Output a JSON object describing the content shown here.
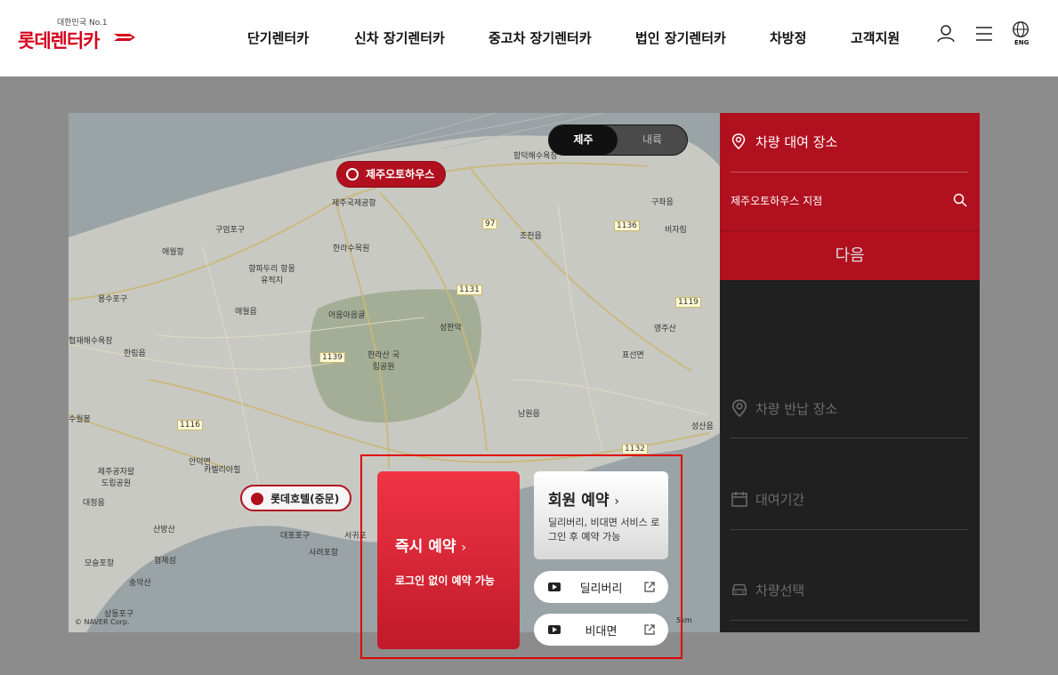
{
  "header": {
    "logo_tagline": "대한민국 No.1",
    "logo_name": "롯데렌터카",
    "nav": [
      "단기렌터카",
      "신차 장기렌터카",
      "중고차 장기렌터카",
      "법인 장기렌터카",
      "차방정",
      "고객지원"
    ],
    "lang_label": "ENG"
  },
  "map": {
    "toggle": {
      "active": "제주",
      "inactive": "내륙"
    },
    "pin_main": "제주오토하우스",
    "pin_secondary": "롯데호텔(중문)",
    "labels": [
      "함덕해수욕장",
      "안덕면",
      "구좌읍",
      "비자림",
      "조천읍",
      "한라수목원",
      "제주국제공항",
      "구엄포구",
      "애월항",
      "애월읍",
      "한림읍",
      "어음아음골",
      "한라산 국립공원",
      "성판악",
      "남원읍",
      "표선면",
      "대정읍",
      "카멜리아힐",
      "서귀포",
      "성산읍",
      "영주산",
      "협재해수욕장",
      "용수포구",
      "향파두리 항몽유적지",
      "제주공자왈 도립공원",
      "산방산",
      "모슬포항",
      "형제섬",
      "송악산",
      "상동포구",
      "대포포구",
      "사려포항",
      "수월봉"
    ],
    "road_numbers": [
      "97",
      "1136",
      "1131",
      "1139",
      "1119",
      "1116",
      "1132"
    ],
    "copyright": "© NAVER Corp.",
    "scale": "5km"
  },
  "panel": {
    "pickup_title": "차량 대여 장소",
    "pickup_value": "제주오토하우스 지점",
    "next_label": "다음",
    "return_title": "차량 반납 장소",
    "period_title": "대여기간",
    "car_title": "차량선택"
  },
  "cards": {
    "instant_title": "즉시 예약",
    "instant_sub": "로그인 없이 예약 가능",
    "member_title": "회원 예약",
    "member_sub": "딜리버리, 비대면 서비스 로그인 후 예약 가능",
    "delivery_label": "딜리버리",
    "contactless_label": "비대면"
  },
  "colors": {
    "brand": "#b1101f",
    "instant_gradient_top": "#f03444",
    "highlight": "#e00000"
  }
}
